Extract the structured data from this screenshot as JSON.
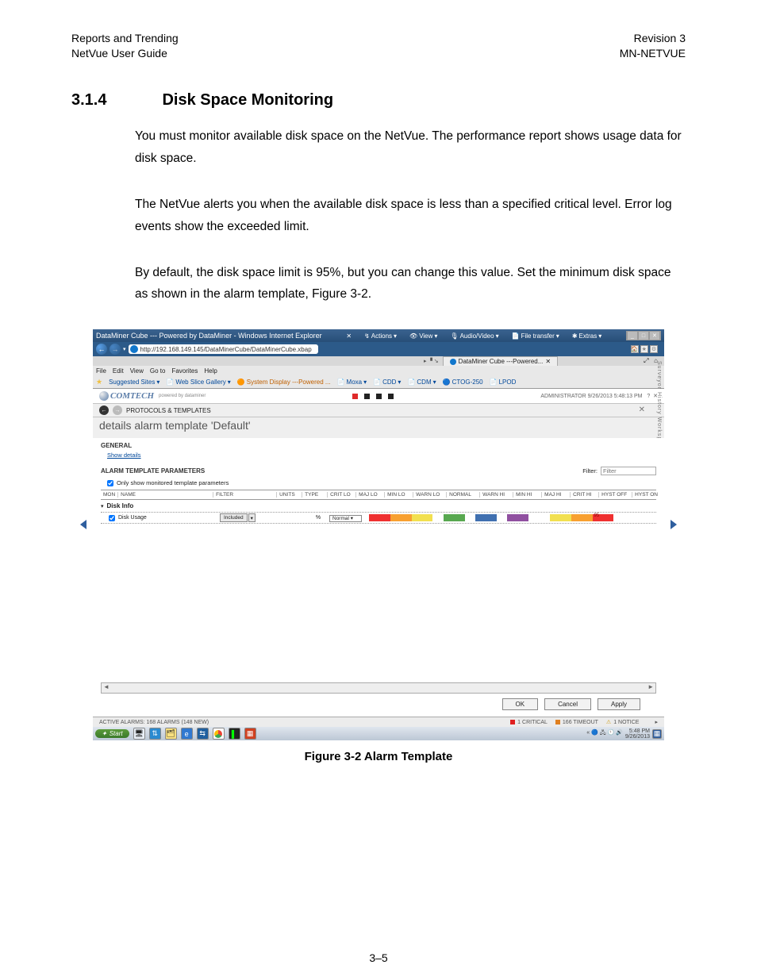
{
  "page_header": {
    "left_top": "Reports and Trending",
    "left_bottom": "NetVue User Guide",
    "right_top": "Revision 3",
    "right_bottom": "MN-NETVUE"
  },
  "section": {
    "number": "3.1.4",
    "title": "Disk Space Monitoring"
  },
  "paragraphs": {
    "p1": "You must monitor available disk space on the NetVue. The performance report shows usage data for disk space.",
    "p2": "The NetVue alerts you when the available disk space is less than a specified critical level. Error log events show the exceeded limit.",
    "p3": "By default, the disk space limit is 95%, but you can change this value. Set the minimum disk space as shown in the alarm template, Figure 3-2."
  },
  "figure_caption": "Figure 3-2 Alarm Template",
  "page_number": "3–5",
  "shot": {
    "titlebar": "DataMiner Cube --- Powered by DataMiner - Windows Internet Explorer",
    "top_menu": {
      "actions": "Actions",
      "view": "View",
      "audiovideo": "Audio/Video",
      "filetransfer": "File transfer",
      "extras": "Extras"
    },
    "addr": "http://192.168.149.145/DataMinerCube/DataMinerCube.xbap",
    "tab_label": "DataMiner Cube ---Powered...",
    "ie_menu": {
      "file": "File",
      "edit": "Edit",
      "view": "View",
      "goto": "Go to",
      "favorites": "Favorites",
      "help": "Help"
    },
    "favbar": {
      "suggested": "Suggested Sites",
      "webslice": "Web Slice Gallery",
      "system": "System Display ---Powered ...",
      "moxa": "Moxa",
      "cdd": "CDD",
      "cdm": "CDM",
      "ctog": "CTOG-250",
      "lpod": "LPOD"
    },
    "logo_text": "COMTECH",
    "logo_sub": "powered by dataminer",
    "admin": "ADMINISTRATOR  9/26/2013 5:48:13 PM",
    "breadcrumb": "PROTOCOLS & TEMPLATES",
    "details_title": "details alarm template 'Default'",
    "general": "GENERAL",
    "show_details": "Show details",
    "param_header": "ALARM TEMPLATE PARAMETERS",
    "filter_label": "Filter:",
    "filter_placeholder": "Filter",
    "only_monitored": "Only show monitored template parameters",
    "grid_headers": {
      "mon": "MON",
      "name": "NAME",
      "filter": "FILTER",
      "units": "UNITS",
      "type": "TYPE",
      "critlo": "CRIT LO",
      "majlo": "MAJ LO",
      "minlo": "MIN LO",
      "warnlo": "WARN LO",
      "normal": "NORMAL",
      "warnhi": "WARN HI",
      "minhi": "MIN HI",
      "majhi": "MAJ HI",
      "crithi": "CRIT HI",
      "hystoff": "HYST OFF",
      "hyston": "HYST ON"
    },
    "group": "Disk Info",
    "row": {
      "name": "Disk Usage",
      "included": "Included",
      "units": "%",
      "type": "Normal",
      "threshold_value": "95"
    },
    "right_tabs": "Surveyor   History   Workspaces",
    "buttons": {
      "ok": "OK",
      "cancel": "Cancel",
      "apply": "Apply"
    },
    "status": {
      "left": "ACTIVE ALARMS: 168 ALARMS (148 NEW)",
      "critical": "1 CRITICAL",
      "timeout": "166 TIMEOUT",
      "notice": "1 NOTICE"
    },
    "taskbar": {
      "start": "Start",
      "time": "5:48 PM",
      "date": "9/26/2013"
    }
  }
}
